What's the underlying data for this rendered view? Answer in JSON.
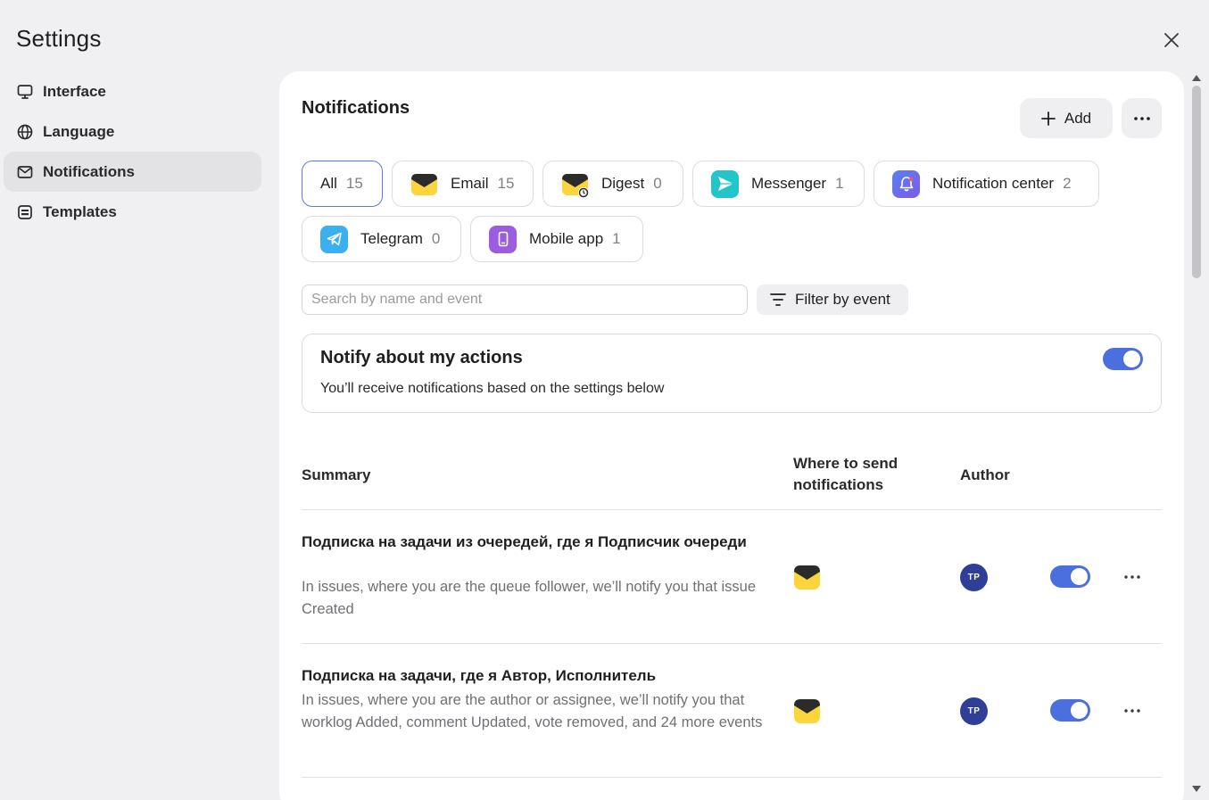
{
  "app": {
    "title": "Settings"
  },
  "sidebar": {
    "items": [
      {
        "label": "Interface",
        "icon": "monitor-icon"
      },
      {
        "label": "Language",
        "icon": "globe-icon"
      },
      {
        "label": "Notifications",
        "icon": "envelope-icon",
        "active": true
      },
      {
        "label": "Templates",
        "icon": "template-icon"
      }
    ]
  },
  "main": {
    "title": "Notifications",
    "add_label": "Add",
    "channels": [
      {
        "label": "All",
        "count": "15",
        "active": true
      },
      {
        "label": "Email",
        "count": "15",
        "icon": "email-icon"
      },
      {
        "label": "Digest",
        "count": "0",
        "icon": "digest-icon"
      },
      {
        "label": "Messenger",
        "count": "1",
        "icon": "messenger-icon"
      },
      {
        "label": "Notification center",
        "count": "2",
        "icon": "bell-icon"
      },
      {
        "label": "Telegram",
        "count": "0",
        "icon": "telegram-icon"
      },
      {
        "label": "Mobile app",
        "count": "1",
        "icon": "mobile-icon"
      }
    ],
    "search": {
      "placeholder": "Search by name and event",
      "value": ""
    },
    "filter_label": "Filter by event",
    "notify_card": {
      "title": "Notify about my actions",
      "description": "You’ll receive notifications based on the settings below",
      "enabled": true
    },
    "table": {
      "headers": {
        "summary": "Summary",
        "where_line1": "Where to send",
        "where_line2": "notifications",
        "author": "Author"
      },
      "rows": [
        {
          "title": "Подписка на задачи из очередей, где я Подписчик очереди",
          "description": "In issues, where you are the queue follower, we’ll notify you that issue Created",
          "channel_icon": "email-icon",
          "author_initials": "TP",
          "enabled": true
        },
        {
          "title": "Подписка на задачи, где я Автор, Исполнитель",
          "description": "In issues, where you are the author or assignee, we’ll notify you that worklog Added, comment Updated, vote removed, and 24 more events",
          "channel_icon": "email-icon",
          "author_initials": "TP",
          "enabled": true
        }
      ]
    }
  },
  "colors": {
    "accent": "#4c6fe0",
    "avatar": "#2f3e96",
    "email_yellow": "#fcd53c"
  }
}
